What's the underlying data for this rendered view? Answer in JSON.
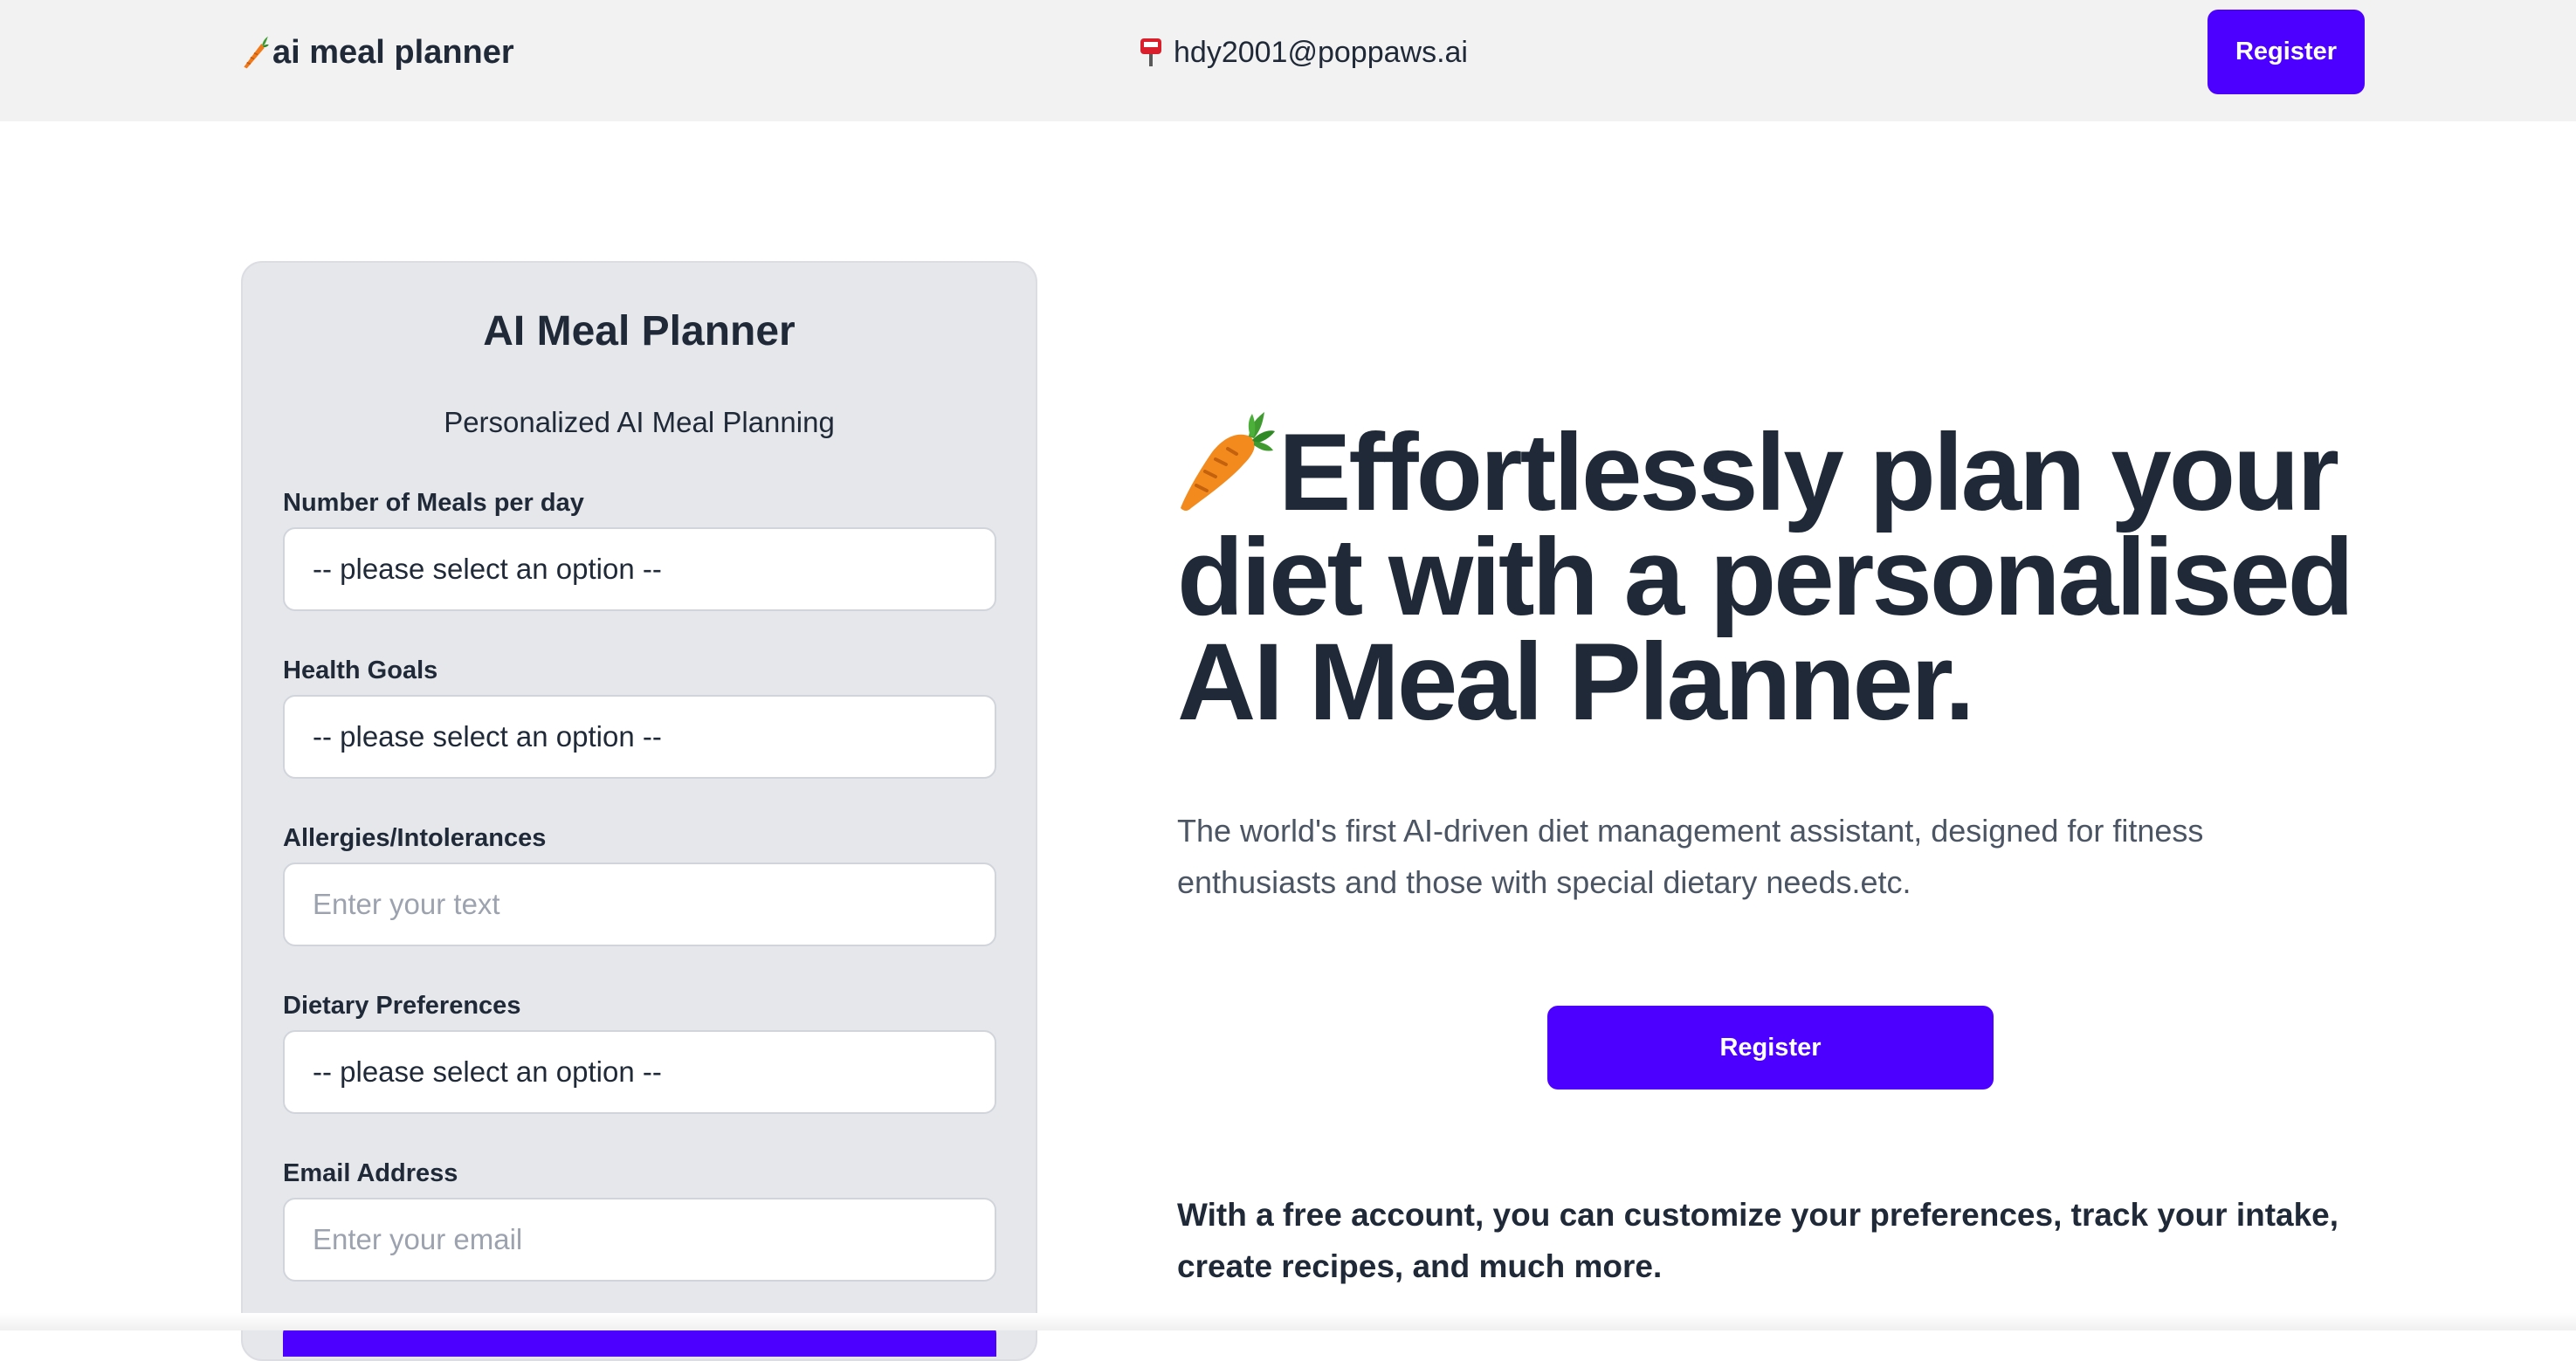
{
  "header": {
    "brand": "ai meal planner",
    "contact_email": "hdy2001@poppaws.ai",
    "register_label": "Register"
  },
  "form": {
    "title": "AI Meal Planner",
    "subtitle": "Personalized AI Meal Planning",
    "fields": [
      {
        "label": "Number of Meals per day",
        "type": "select",
        "value": "-- please select an option --"
      },
      {
        "label": "Health Goals",
        "type": "select",
        "value": "-- please select an option --"
      },
      {
        "label": "Allergies/Intolerances",
        "type": "text",
        "placeholder": "Enter your text"
      },
      {
        "label": "Dietary Preferences",
        "type": "select",
        "value": "-- please select an option --"
      },
      {
        "label": "Email Address",
        "type": "email",
        "placeholder": "Enter your email"
      }
    ]
  },
  "hero": {
    "headline": "Effortlessly plan your diet with a personalised AI Meal Planner.",
    "description": "The world's first AI-driven diet management assistant, designed for fitness enthusiasts and those with special dietary needs.etc.",
    "register_label": "Register",
    "note": "With a free account, you can customize your preferences, track your intake, create recipes, and much more."
  },
  "icons": {
    "brand": "carrot-icon",
    "contact": "mailbox-icon",
    "hero": "carrot-icon"
  },
  "colors": {
    "accent": "#4c00ff",
    "header_bg": "#f2f2f2",
    "card_bg": "#e5e7eb",
    "text": "#1f2937"
  }
}
